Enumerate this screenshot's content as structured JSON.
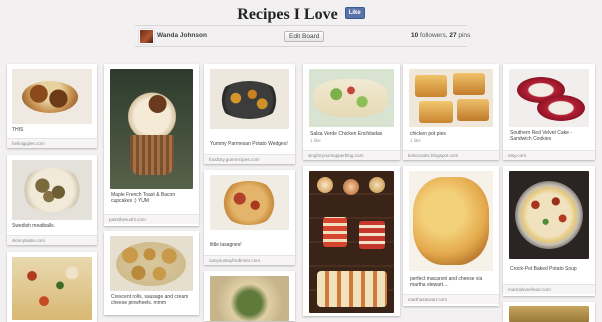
{
  "board": {
    "title": "Recipes I Love",
    "like_button": "Like",
    "owner": "Wanda Johnson",
    "edit_button": "Edit Board",
    "followers": "10",
    "followers_label": "followers,",
    "pins": "27",
    "pins_label": "pins"
  },
  "pins": [
    {
      "description": "THIS",
      "source": "helloigigles.com"
    },
    {
      "description": "Swedish meatballs.",
      "source": "skinnytaste.com"
    },
    {
      "description": "",
      "source": ""
    },
    {
      "description": "Maple French Toast & Bacon cupcakes :) YUM",
      "source": "passthesushi.com"
    },
    {
      "description": "Crescent rolls, sausage and cream cheese pinwheels. mmm",
      "source": ""
    },
    {
      "description": "Yummy Parmesan Potato Wedges!",
      "source": "foodcity.gumrecipes.com"
    },
    {
      "description": "little lasagnes!",
      "source": "canyoustayfordinner.com"
    },
    {
      "description": "",
      "source": ""
    },
    {
      "description": "Salsa Verde Chicken Enchiladas",
      "likes": "1 like",
      "source": "singforyoursupperblog.com"
    },
    {
      "description": "",
      "source": ""
    },
    {
      "description": "chicken pot pies",
      "likes": "1 like",
      "source": "kokocooks.blogspot.com"
    },
    {
      "description": "perfect macaroni and cheese via martha stewart....",
      "source": "marthastewart.com"
    },
    {
      "description": "Southern Red Velvet Cake - Sandwich Cookies",
      "source": "etsy.com"
    },
    {
      "description": "Crock-Pot Baked Potato Soup",
      "source": "mamaloveefood.com"
    }
  ],
  "colors": {
    "page_bg": "#f2f0f0",
    "fb_like": "#5b74a8"
  }
}
